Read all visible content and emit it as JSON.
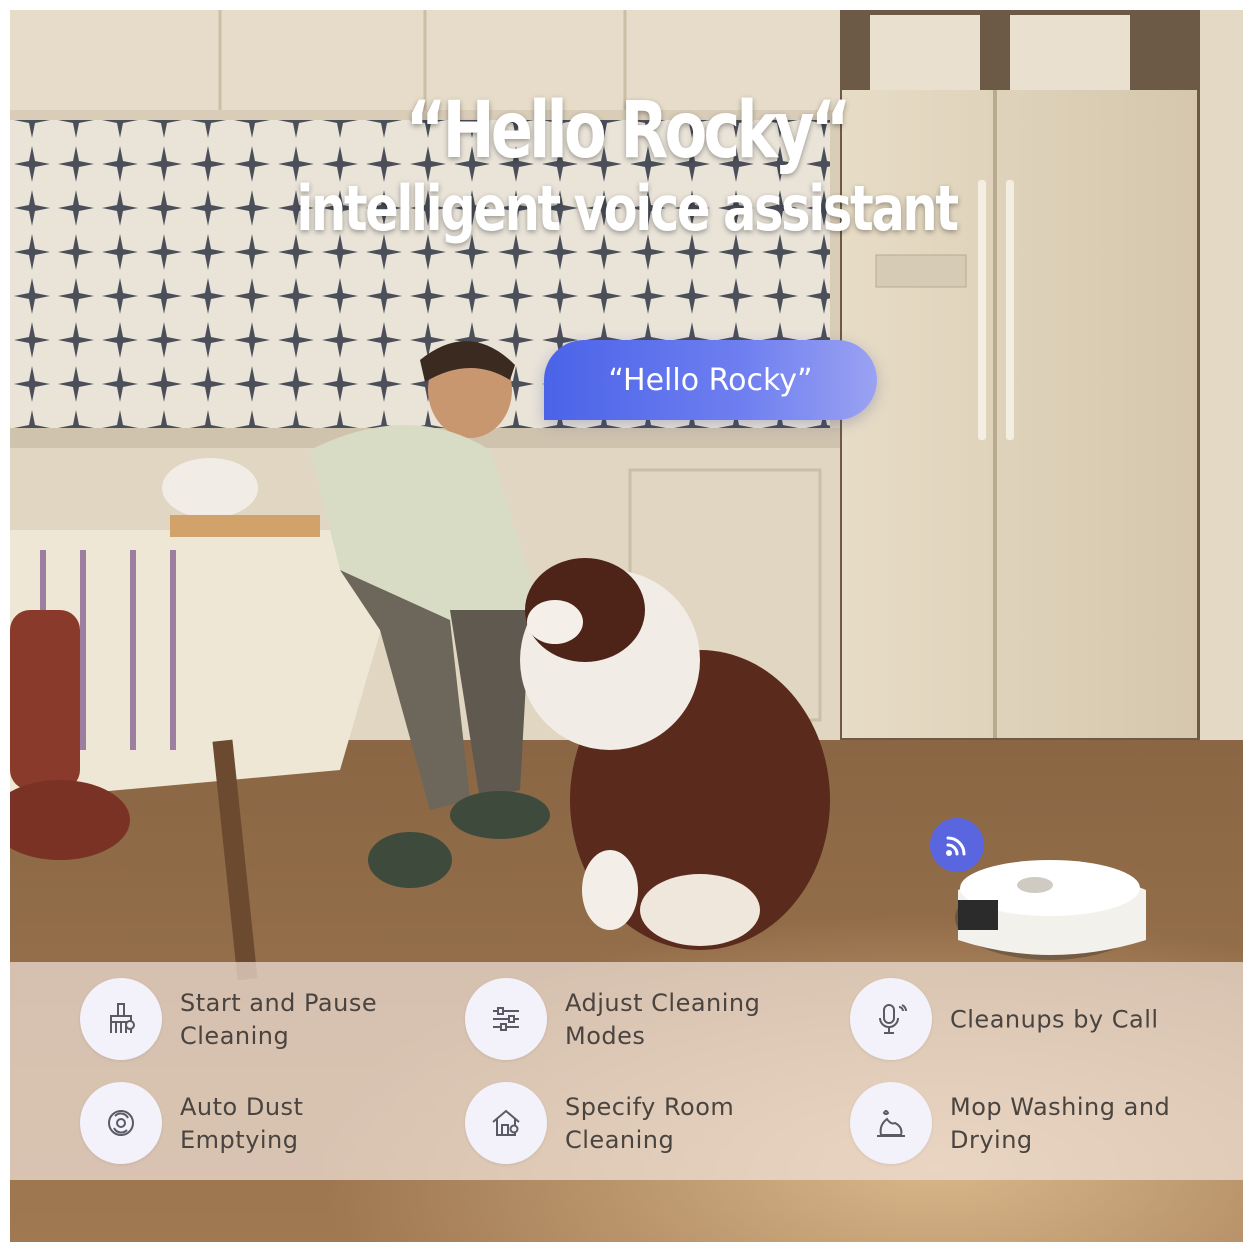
{
  "heading": {
    "line1": "“Hello Rocky“",
    "line2": "intelligent voice assistant"
  },
  "bubble": {
    "text": "“Hello Rocky”",
    "color": "#4a63e8"
  },
  "features": [
    {
      "label": "Start and Pause Cleaning",
      "icon": "broom-icon"
    },
    {
      "label": "Adjust Cleaning Modes",
      "icon": "sliders-icon"
    },
    {
      "label": "Cleanups by Call",
      "icon": "microphone-icon"
    },
    {
      "label": "Auto Dust Emptying",
      "icon": "swirl-icon"
    },
    {
      "label": "Specify Room Cleaning",
      "icon": "house-icon"
    },
    {
      "label": "Mop Washing and Drying",
      "icon": "mop-icon"
    }
  ],
  "colors": {
    "accent": "#5a66e0",
    "panel": "#f0e1d7",
    "icon_circle": "#f3f2fa",
    "icon_stroke": "#5a5a66"
  }
}
